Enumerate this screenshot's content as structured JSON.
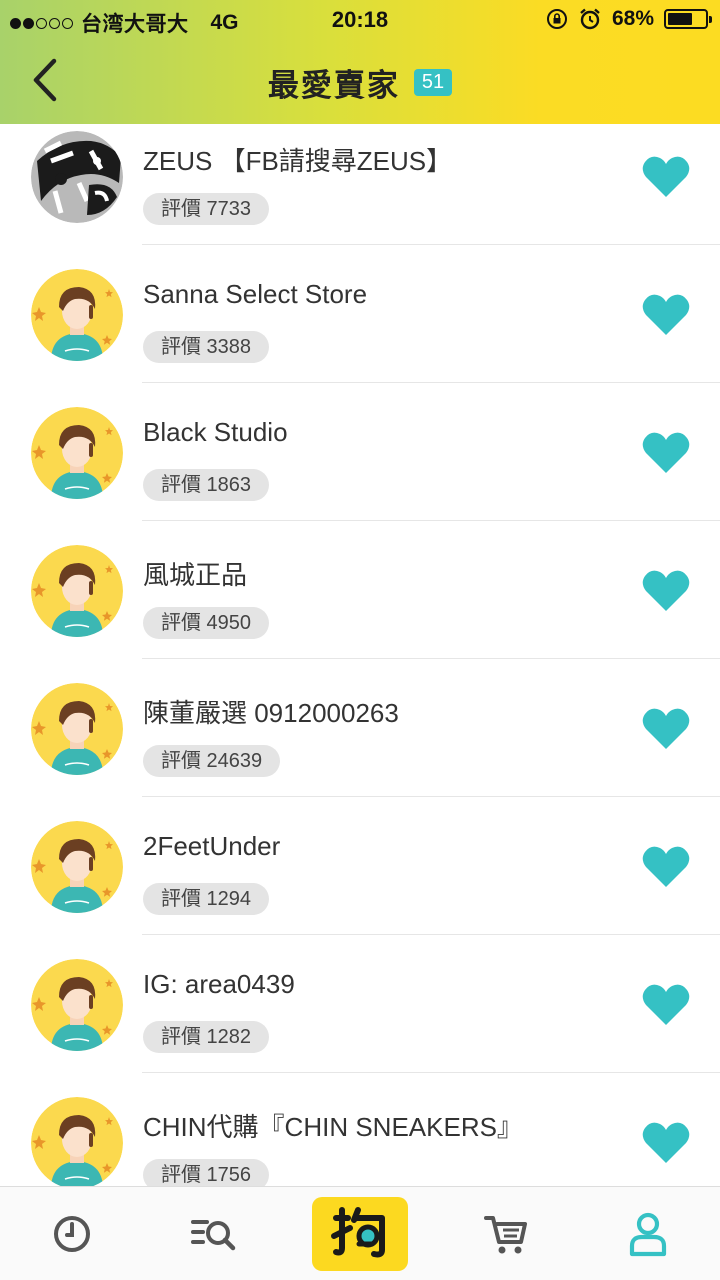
{
  "status_bar": {
    "carrier": "台湾大哥大",
    "network": "4G",
    "time": "20:18",
    "battery": "68%",
    "battery_level": 0.68,
    "signal_bars_filled": 2,
    "signal_bars_total": 5
  },
  "header": {
    "title": "最愛賣家",
    "count": "51"
  },
  "colors": {
    "accent": "#35c1c4",
    "header_yellow": "#fcdc22",
    "header_green": "#a8d26a",
    "tab_center": "#fcd920",
    "rating_pill": "#e4e4e4"
  },
  "sellers": [
    {
      "name": "ZEUS 【FB請搜尋ZEUS】",
      "rating": "評價 7733",
      "avatar": "zeus-logo"
    },
    {
      "name": "Sanna Select Store",
      "rating": "評價 3388",
      "avatar": "default-avatar"
    },
    {
      "name": "Black Studio",
      "rating": "評價 1863",
      "avatar": "default-avatar"
    },
    {
      "name": "風城正品",
      "rating": "評價 4950",
      "avatar": "default-avatar"
    },
    {
      "name": "陳董嚴選 0912000263",
      "rating": "評價 24639",
      "avatar": "default-avatar"
    },
    {
      "name": "2FeetUnder",
      "rating": "評價 1294",
      "avatar": "default-avatar"
    },
    {
      "name": "IG: area0439",
      "rating": "評價 1282",
      "avatar": "default-avatar"
    },
    {
      "name": "CHIN代購『CHIN SNEAKERS』",
      "rating": "評價 1756",
      "avatar": "default-avatar"
    }
  ],
  "tabbar": {
    "items": [
      {
        "icon": "clock-icon"
      },
      {
        "icon": "search-list-icon"
      },
      {
        "icon": "grab-logo-icon",
        "label": "抱"
      },
      {
        "icon": "cart-icon"
      },
      {
        "icon": "person-icon",
        "active": true
      }
    ]
  }
}
